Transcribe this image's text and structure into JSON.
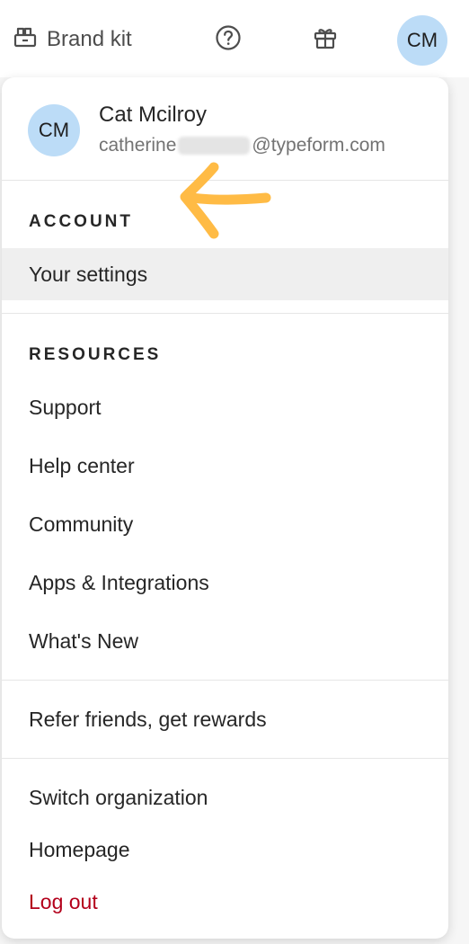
{
  "topbar": {
    "brand_kit_label": "Brand kit",
    "help_icon": "question-circle-icon",
    "gift_icon": "gift-icon",
    "avatar_initials": "CM"
  },
  "profile": {
    "initials": "CM",
    "name": "Cat Mcilroy",
    "email_prefix": "catherine",
    "email_domain": "@typeform.com"
  },
  "sections": {
    "account_title": "ACCOUNT",
    "resources_title": "RESOURCES"
  },
  "items": {
    "your_settings": "Your settings",
    "support": "Support",
    "help_center": "Help center",
    "community": "Community",
    "apps_integrations": "Apps & Integrations",
    "whats_new": "What's New",
    "refer": "Refer friends, get rewards",
    "switch_org": "Switch organization",
    "homepage": "Homepage",
    "log_out": "Log out"
  },
  "colors": {
    "avatar_bg": "#bcdcf7",
    "highlight_bg": "#efefef",
    "logout_red": "#b3001b",
    "arrow_orange": "#ffbb45"
  }
}
